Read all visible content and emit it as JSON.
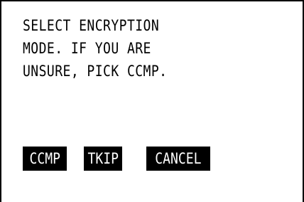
{
  "message": {
    "lines": [
      "SELECT ENCRYPTION",
      "MODE. IF YOU ARE",
      "UNSURE, PICK CCMP."
    ]
  },
  "softkeys": [
    {
      "label": "CCMP"
    },
    {
      "label": "TKIP"
    },
    {
      "label": "CANCEL"
    }
  ],
  "colors": {
    "background": "#ffffff",
    "text": "#000000",
    "softkey_background": "#000000",
    "softkey_text": "#ffffff"
  }
}
